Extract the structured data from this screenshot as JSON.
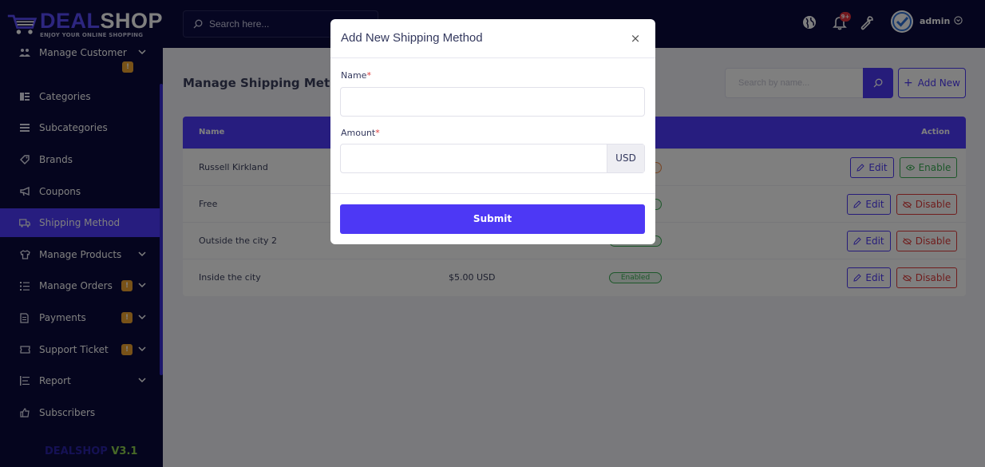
{
  "brand": {
    "name_part1": "DEAL",
    "name_part2": "SHOP",
    "tagline": "ENJOY YOUR ONLINE SHOPPING",
    "version_part1": "DEALSHOP",
    "version_part2": "V3.1"
  },
  "topbar": {
    "search_placeholder": "Search here...",
    "notification_count": "9+",
    "user_name": "admin"
  },
  "sidebar": {
    "items": [
      {
        "label": "Manage Customer",
        "icon": "users-icon",
        "has_chevron": true
      },
      {
        "label": "Categories",
        "icon": "categories-icon"
      },
      {
        "label": "Subcategories",
        "icon": "subcategories-icon"
      },
      {
        "label": "Brands",
        "icon": "tag-icon"
      },
      {
        "label": "Coupons",
        "icon": "megaphone-icon"
      },
      {
        "label": "Shipping Method",
        "icon": "truck-icon",
        "active": true
      },
      {
        "label": "Manage Products",
        "icon": "shirt-icon",
        "has_chevron": true
      },
      {
        "label": "Manage Orders",
        "icon": "list-icon",
        "has_chevron": true,
        "badge": "!"
      },
      {
        "label": "Payments",
        "icon": "receipt-icon",
        "has_chevron": true,
        "badge": "!"
      },
      {
        "label": "Support Ticket",
        "icon": "ticket-icon",
        "has_chevron": true,
        "badge": "!"
      },
      {
        "label": "Report",
        "icon": "report-icon",
        "has_chevron": true
      },
      {
        "label": "Subscribers",
        "icon": "thumbs-up-icon"
      }
    ],
    "customer_badge": "!"
  },
  "page": {
    "title": "Manage Shipping Methods",
    "search_placeholder": "Search by name...",
    "add_button": "Add New",
    "columns": {
      "name": "Name",
      "action": "Action"
    },
    "rows": [
      {
        "name": "Russell Kirkland",
        "amount": "",
        "status": "",
        "toggle_label": "Enable"
      },
      {
        "name": "Free",
        "amount": "",
        "status": "",
        "toggle_label": "Disable"
      },
      {
        "name": "Outside the city 2",
        "amount": "",
        "status": "",
        "toggle_label": "Disable"
      },
      {
        "name": "Inside the city",
        "amount": "$5.00 USD",
        "status": "Enabled",
        "toggle_label": "Disable"
      }
    ],
    "edit_label": "Edit"
  },
  "modal": {
    "title": "Add New Shipping Method",
    "close_symbol": "×",
    "name_label": "Name",
    "amount_label": "Amount",
    "required_mark": "*",
    "name_value": "",
    "amount_value": "",
    "currency": "USD",
    "submit_label": "Submit"
  },
  "colors": {
    "primary": "#4f3bff",
    "sidebar_bg": "#0a0a3c",
    "success": "#3aaf55",
    "danger": "#e03b3b",
    "warning": "#f0a431"
  }
}
